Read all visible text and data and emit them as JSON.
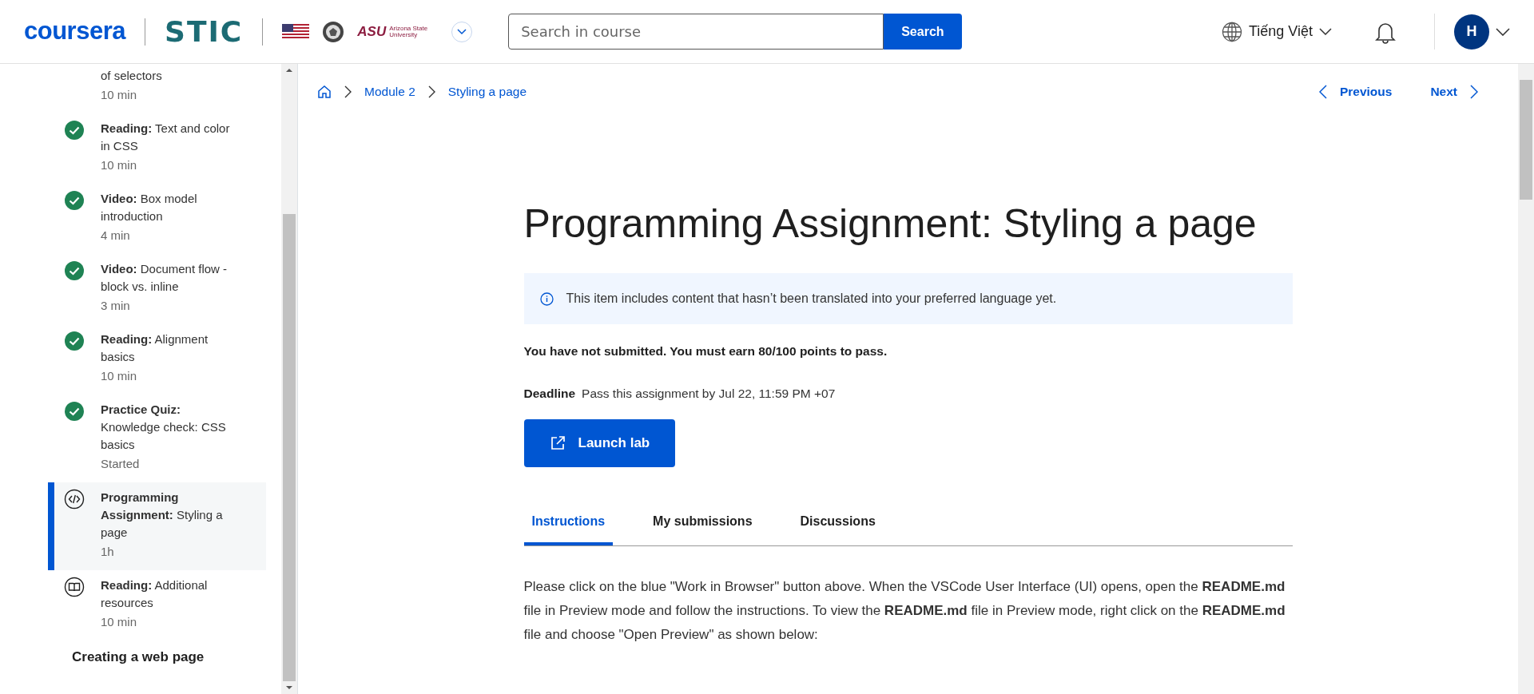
{
  "header": {
    "logo": "coursera",
    "partner_logo": "STIC",
    "asu_mark": "ASU",
    "asu_name": "Arizona State University",
    "search": {
      "placeholder": "Search in course",
      "button": "Search"
    },
    "language": "Tiếng Việt",
    "avatar": "H"
  },
  "sidebar": {
    "items": [
      {
        "kind": "continued",
        "title": "of selectors",
        "meta": "10 min",
        "selected": false
      },
      {
        "kind": "completed",
        "type": "Reading:",
        "title": "Text and color in CSS",
        "meta": "10 min",
        "selected": false
      },
      {
        "kind": "completed",
        "type": "Video:",
        "title": "Box model introduction",
        "meta": "4 min",
        "selected": false
      },
      {
        "kind": "completed",
        "type": "Video:",
        "title": "Document flow - block vs. inline",
        "meta": "3 min",
        "selected": false
      },
      {
        "kind": "completed",
        "type": "Reading:",
        "title": "Alignment basics",
        "meta": "10 min",
        "selected": false
      },
      {
        "kind": "completed",
        "type": "Practice Quiz:",
        "title": "Knowledge check: CSS basics",
        "meta": "Started",
        "selected": false
      },
      {
        "kind": "assignment",
        "type": "Programming Assignment:",
        "title": "Styling a page",
        "meta": "1h",
        "selected": true
      },
      {
        "kind": "reading",
        "type": "Reading:",
        "title": "Additional resources",
        "meta": "10 min",
        "selected": false
      }
    ],
    "section": "Creating a web page"
  },
  "breadcrumb": [
    "Module 2",
    "Styling a page"
  ],
  "nav": {
    "previous": "Previous",
    "next": "Next"
  },
  "title": "Programming Assignment: Styling a page",
  "notice": "This item includes content that hasn’t been translated into your preferred language yet.",
  "status": "You have not submitted. You must earn 80/100 points to pass.",
  "deadline": {
    "label": "Deadline",
    "text": "Pass this assignment by Jul 22, 11:59 PM +07"
  },
  "launch_button": "Launch lab",
  "tabs": [
    {
      "label": "Instructions",
      "selected": true
    },
    {
      "label": "My submissions",
      "selected": false
    },
    {
      "label": "Discussions",
      "selected": false
    }
  ],
  "instructions": "Please click on the blue \"Work in Browser\" button above. When the VSCode User Interface (UI) opens, open the **README.md** file in  Preview mode and follow the instructions. To view the **README.md** file in Preview mode, right click on the **README.md** file and choose \"Open Preview\" as shown below:"
}
